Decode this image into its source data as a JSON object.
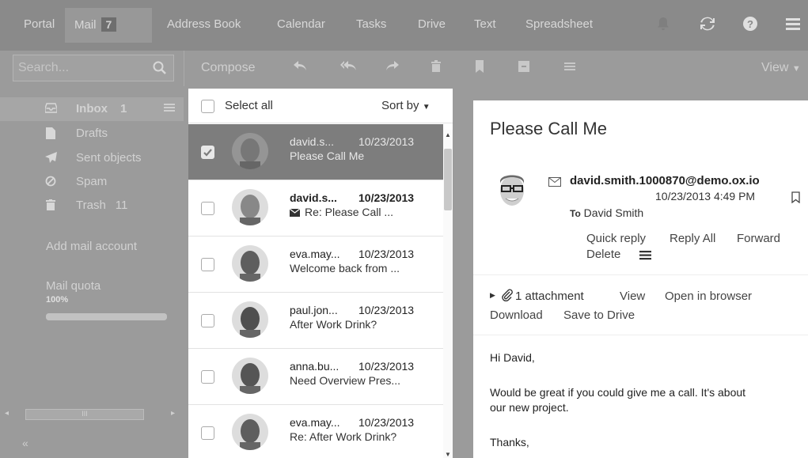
{
  "topnav": {
    "items": [
      "Portal",
      "Mail",
      "Address Book",
      "Calendar",
      "Tasks",
      "Drive",
      "Text",
      "Spreadsheet"
    ],
    "mail_badge": "7",
    "icons": [
      "bell-icon",
      "refresh-icon",
      "help-icon",
      "menu-icon"
    ]
  },
  "toolbar": {
    "search_placeholder": "Search...",
    "compose": "Compose",
    "view": "View"
  },
  "sidebar": {
    "inbox": "Inbox",
    "inbox_count": "1",
    "drafts": "Drafts",
    "sent": "Sent objects",
    "spam": "Spam",
    "trash": "Trash",
    "trash_count": "11",
    "add_account": "Add mail account",
    "quota_label": "Mail quota",
    "quota_value": "100%",
    "quota_fraction": 1.0,
    "hscroll_glyph": "III",
    "collapse": "«"
  },
  "list": {
    "select_all": "Select all",
    "sort_by": "Sort by",
    "rows": [
      {
        "sender": "david.s...",
        "date": "10/23/2013",
        "subject": "Please Call Me",
        "selected": true,
        "bold": false
      },
      {
        "sender": "david.s...",
        "date": "10/23/2013",
        "subject": "Re: Please Call ...",
        "selected": false,
        "bold": true
      },
      {
        "sender": "eva.may...",
        "date": "10/23/2013",
        "subject": "Welcome back from ...",
        "selected": false,
        "bold": false
      },
      {
        "sender": "paul.jon...",
        "date": "10/23/2013",
        "subject": "After Work Drink?",
        "selected": false,
        "bold": false
      },
      {
        "sender": "anna.bu...",
        "date": "10/23/2013",
        "subject": "Need Overview Pres...",
        "selected": false,
        "bold": false
      },
      {
        "sender": "eva.may...",
        "date": "10/23/2013",
        "subject": "Re: After Work Drink?",
        "selected": false,
        "bold": false
      }
    ]
  },
  "detail": {
    "title": "Please Call Me",
    "from": "david.smith.1000870@demo.ox.io",
    "datetime": "10/23/2013 4:49 PM",
    "to_label": "To",
    "to_value": "David Smith",
    "actions": [
      "Quick reply",
      "Reply All",
      "Forward",
      "Delete"
    ],
    "attachment": "1 attachment",
    "view": "View",
    "open_browser": "Open in browser",
    "download": "Download",
    "save_drive": "Save to Drive",
    "body": [
      "Hi David,",
      "Would be great if you could give me a call. It's about",
      "our new project.",
      "Thanks,"
    ]
  }
}
